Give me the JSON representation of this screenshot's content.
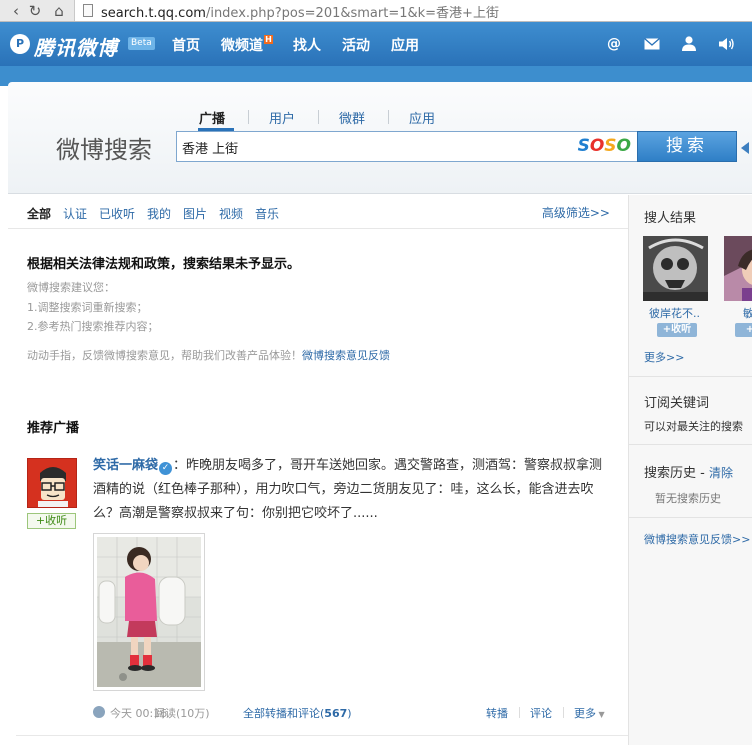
{
  "browser": {
    "url_host": "search.t.qq.com",
    "url_rest": "/index.php?pos=201&smart=1&k=香港+上街"
  },
  "topnav": {
    "logo": "腾讯微博",
    "beta": "Beta",
    "items": [
      {
        "label": "首页"
      },
      {
        "label": "微频道",
        "badge": "H"
      },
      {
        "label": "找人"
      },
      {
        "label": "活动"
      },
      {
        "label": "应用"
      }
    ]
  },
  "search": {
    "title": "微博搜索",
    "tabs": [
      {
        "label": "广播",
        "active": true
      },
      {
        "label": "用户"
      },
      {
        "label": "微群"
      },
      {
        "label": "应用"
      }
    ],
    "query": "香港 上街",
    "engine_logo": "SOSO",
    "button_label": "搜索"
  },
  "filters": {
    "tabs": [
      {
        "label": "全部",
        "active": true
      },
      {
        "label": "认证"
      },
      {
        "label": "已收听"
      },
      {
        "label": "我的"
      },
      {
        "label": "图片"
      },
      {
        "label": "视频"
      },
      {
        "label": "音乐"
      }
    ],
    "advanced": "高级筛选>>"
  },
  "notice": {
    "title": "根据相关法律法规和政策，搜索结果未予显示。",
    "suggest_title": "微博搜索建议您：",
    "suggest_1": "1.调整搜索词重新搜索；",
    "suggest_2": "2.参考热门搜索推荐内容；",
    "feedback_text": "动动手指，反馈微博搜索意见，帮助我们改善产品体验！",
    "feedback_link": "微博搜索意见反馈"
  },
  "recommended": {
    "title": "推荐广播",
    "post": {
      "author": "笑话一麻袋",
      "text": "：昨晚朋友喝多了，哥开车送她回家。遇交警路查，测酒驾：警察叔叔拿测酒精的说（红色棒子那种），用力吹口气，旁边二货朋友见了：哇，这么长，能含进去吹么？高潮是警察叔叔来了句：你别把它咬坏了......",
      "follow": "+收听",
      "time": "今天 00:16",
      "reads": "阅读(10万)",
      "all_label": "全部转播和评论(",
      "all_count": "567",
      "all_close": ")",
      "forward": "转播",
      "comment": "评论",
      "more": "更多"
    }
  },
  "sidebar": {
    "people_title": "搜人结果",
    "people": [
      {
        "name": "彼岸花不..",
        "follow": "+收听"
      },
      {
        "name": "敏",
        "follow": "+收"
      }
    ],
    "more": "更多>>",
    "subscribe_title": "订阅关键词",
    "subscribe_desc": "可以对最关注的搜索",
    "history_title": "搜索历史 - ",
    "history_clear": "清除",
    "history_empty": "暂无搜索历史",
    "feedback": "微博搜索意见反馈>>"
  },
  "colors": {
    "brand_blue": "#2a72b8",
    "link_blue": "#2e6aa7",
    "soso_s1": "#1f7fd0",
    "soso_o1": "#e8312b",
    "soso_s2": "#f4a81d",
    "soso_o2": "#3aa845"
  }
}
